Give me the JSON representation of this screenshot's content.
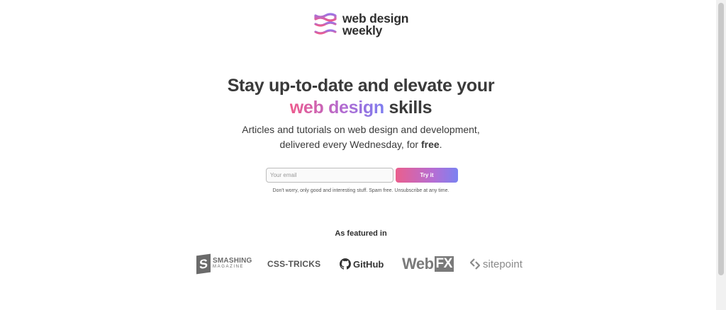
{
  "brand": {
    "name_line1": "web design",
    "name_line2": "weekly",
    "colors": {
      "pink": "#ee5a8c",
      "purple": "#b36ad0",
      "blue": "#7d7df0",
      "text": "#3a3a3a"
    }
  },
  "hero": {
    "headline_part1": "Stay up-to-date and elevate your",
    "headline_highlight": "web design",
    "headline_part2": " skills",
    "subtitle_line1": "Articles and tutorials on web design and development,",
    "subtitle_line2_prefix": "delivered every Wednesday, for ",
    "subtitle_bold": "free",
    "subtitle_suffix": "."
  },
  "signup": {
    "email_placeholder": "Your email",
    "email_value": "",
    "button_label": "Try it",
    "note": "Don't worry, only good and interesting stuff. Spam free. Unsubscribe at any time."
  },
  "featured": {
    "title": "As featured in",
    "smashing_badge": "S",
    "smashing_main": "SMASHING",
    "smashing_sub": "MAGAZINE",
    "csstricks": "CSS-TRICKS",
    "github": "GitHub",
    "webfx_web": "Web",
    "webfx_fx": "FX",
    "sitepoint": "sitepoint",
    "icons": [
      "waves-logo-icon",
      "github-octocat-icon",
      "sitepoint-chevron-icon"
    ]
  }
}
